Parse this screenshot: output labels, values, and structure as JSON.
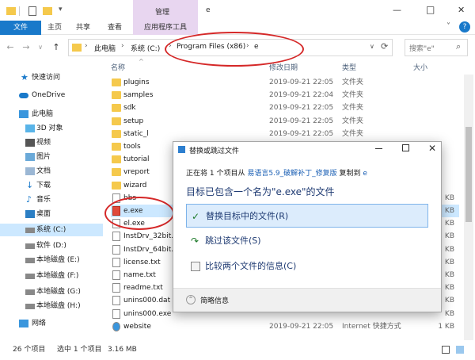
{
  "window": {
    "title": "e",
    "manage_tab": "管理",
    "controls": {
      "minimize": "—",
      "maximize": "□",
      "close": "✕"
    },
    "qat_arrow": "▾"
  },
  "ribbon": {
    "tabs": [
      "文件",
      "主页",
      "共享",
      "查看",
      "应用程序工具"
    ],
    "collapse": "˅",
    "help": "?"
  },
  "address": {
    "back": "←",
    "forward": "→",
    "down": "∨",
    "up": "↑",
    "sep": "›",
    "crumbs": [
      "此电脑",
      "系统 (C:)",
      "Program Files (x86)",
      "e"
    ],
    "dropdown": "∨",
    "refresh": "⟳",
    "search_placeholder": "搜索\"e\"",
    "search_icon": "⌕"
  },
  "nav": {
    "quick_access": "快速访问",
    "onedrive": "OneDrive",
    "this_pc": "此电脑",
    "items": [
      "3D 对象",
      "视频",
      "图片",
      "文档",
      "下载",
      "音乐",
      "桌面",
      "系统 (C:)",
      "软件 (D:)",
      "本地磁盘 (E:)",
      "本地磁盘 (F:)",
      "本地磁盘 (G:)",
      "本地磁盘 (H:)"
    ],
    "network": "网络"
  },
  "columns": {
    "name": "名称",
    "date": "修改日期",
    "type": "类型",
    "size": "大小",
    "sort_arrow": "^"
  },
  "files": [
    {
      "name": "plugins",
      "date": "2019-09-21 22:05",
      "type": "文件夹",
      "size": "",
      "kind": "folder"
    },
    {
      "name": "samples",
      "date": "2019-09-21 22:04",
      "type": "文件夹",
      "size": "",
      "kind": "folder"
    },
    {
      "name": "sdk",
      "date": "2019-09-21 22:05",
      "type": "文件夹",
      "size": "",
      "kind": "folder"
    },
    {
      "name": "setup",
      "date": "2019-09-21 22:05",
      "type": "文件夹",
      "size": "",
      "kind": "folder"
    },
    {
      "name": "static_l",
      "date": "2019-09-21 22:05",
      "type": "文件夹",
      "size": "",
      "kind": "folder"
    },
    {
      "name": "tools",
      "date": "",
      "type": "",
      "size": "",
      "kind": "folder"
    },
    {
      "name": "tutorial",
      "date": "",
      "type": "",
      "size": "",
      "kind": "folder"
    },
    {
      "name": "vreport",
      "date": "",
      "type": "",
      "size": "",
      "kind": "folder"
    },
    {
      "name": "wizard",
      "date": "",
      "type": "",
      "size": "",
      "kind": "folder"
    },
    {
      "name": "bbs",
      "date": "",
      "type": "",
      "size": "KB",
      "kind": "file"
    },
    {
      "name": "e.exe",
      "date": "",
      "type": "",
      "size": "KB",
      "kind": "exe"
    },
    {
      "name": "el.exe",
      "date": "",
      "type": "",
      "size": "KB",
      "kind": "file"
    },
    {
      "name": "InstDrv_32bit.",
      "date": "",
      "type": "",
      "size": "KB",
      "kind": "file"
    },
    {
      "name": "InstDrv_64bit.",
      "date": "",
      "type": "",
      "size": "KB",
      "kind": "file"
    },
    {
      "name": "license.txt",
      "date": "",
      "type": "",
      "size": "KB",
      "kind": "file"
    },
    {
      "name": "name.txt",
      "date": "",
      "type": "",
      "size": "KB",
      "kind": "file"
    },
    {
      "name": "readme.txt",
      "date": "",
      "type": "",
      "size": "KB",
      "kind": "file"
    },
    {
      "name": "unins000.dat",
      "date": "",
      "type": "",
      "size": "KB",
      "kind": "file"
    },
    {
      "name": "unins000.exe",
      "date": "",
      "type": "",
      "size": "KB",
      "kind": "file"
    },
    {
      "name": "website",
      "date": "2019-09-21 22:05",
      "type": "Internet 快捷方式",
      "size": "1 KB",
      "kind": "link"
    }
  ],
  "status": {
    "count": "26 个项目",
    "selected": "选中 1 个项目",
    "size": "3.16 MB"
  },
  "dialog": {
    "title": "替换或跳过文件",
    "close": "✕",
    "line1_prefix": "正在将 1 个项目从",
    "line1_source": "易语言5.9_破解补丁_修复版",
    "line1_mid": "复制到",
    "line1_dest": "e",
    "line2": "目标已包含一个名为\"e.exe\"的文件",
    "options": [
      "替换目标中的文件(R)",
      "跳过该文件(S)",
      "比较两个文件的信息(C)"
    ],
    "details": "简略信息",
    "check_glyph": "✓",
    "details_glyph": "⌃"
  }
}
